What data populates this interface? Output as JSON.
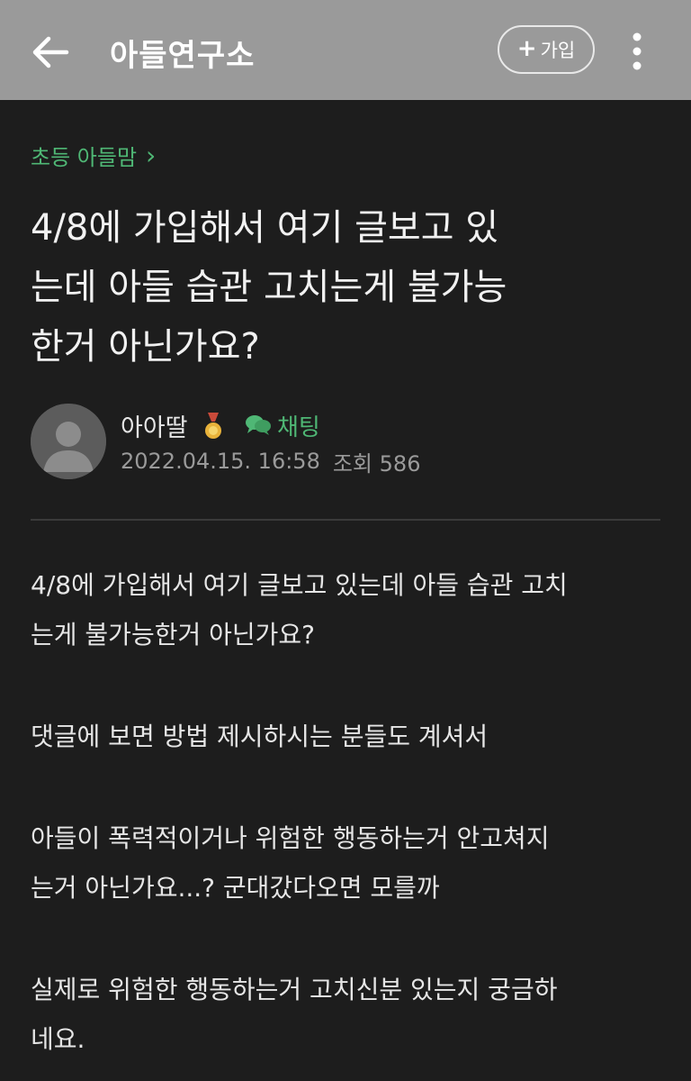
{
  "header": {
    "title": "아들연구소",
    "join_plus": "+",
    "join_label": "가입",
    "back_icon": "arrow-left-icon",
    "more_icon": "vertical-dots-icon",
    "bar_color": "#9a9a9a"
  },
  "board": {
    "name": "초등 아들맘",
    "chevron": "›"
  },
  "post": {
    "title_lines": [
      "4/8에 가입해서 여기 글보고 있",
      "는데 아들 습관 고치는게 불가능",
      "한거 아닌가요?"
    ],
    "author": "아아딸",
    "author_badge_icon": "medal-icon",
    "chat_label": "채팅",
    "chat_icon": "chat-bubbles-icon",
    "date": "2022.04.15. 16:58",
    "views_label": "조회",
    "views": "586",
    "paragraphs": [
      [
        "4/8에 가입해서 여기 글보고 있는데 아들 습관 고치",
        "는게 불가능한거 아닌가요?"
      ],
      [
        "댓글에 보면 방법 제시하시는 분들도 계셔서"
      ],
      [
        "아들이 폭력적이거나 위험한 행동하는거 안고쳐지",
        "는거 아닌가요...? 군대갔다오면 모를까"
      ],
      [
        "실제로 위험한 행동하는거 고치신분 있는지 궁금하",
        "네요."
      ]
    ]
  },
  "colors": {
    "background": "#1d1d1d",
    "accent_green": "#4fb775",
    "meta_gray": "#9a9a9a"
  }
}
